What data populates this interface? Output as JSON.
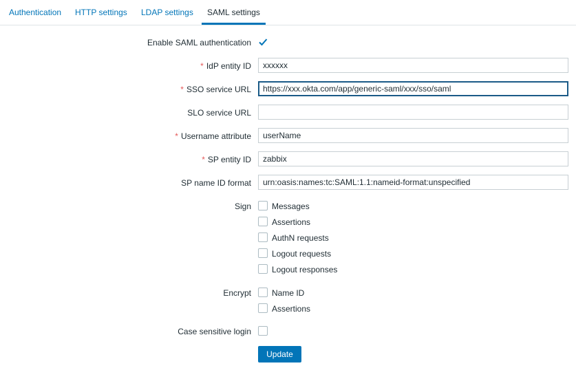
{
  "tabs": [
    {
      "label": "Authentication",
      "active": false
    },
    {
      "label": "HTTP settings",
      "active": false
    },
    {
      "label": "LDAP settings",
      "active": false
    },
    {
      "label": "SAML settings",
      "active": true
    }
  ],
  "form": {
    "enable_saml_label": "Enable SAML authentication",
    "enable_saml_checked": true,
    "idp_entity_id_label": "IdP entity ID",
    "idp_entity_id_value": "xxxxxx",
    "sso_url_label": "SSO service URL",
    "sso_url_value": "https://xxx.okta.com/app/generic-saml/xxx/sso/saml",
    "slo_url_label": "SLO service URL",
    "slo_url_value": "",
    "username_attr_label": "Username attribute",
    "username_attr_value": "userName",
    "sp_entity_id_label": "SP entity ID",
    "sp_entity_id_value": "zabbix",
    "sp_name_id_label": "SP name ID format",
    "sp_name_id_value": "urn:oasis:names:tc:SAML:1.1:nameid-format:unspecified",
    "sign_label": "Sign",
    "sign_options": [
      "Messages",
      "Assertions",
      "AuthN requests",
      "Logout requests",
      "Logout responses"
    ],
    "encrypt_label": "Encrypt",
    "encrypt_options": [
      "Name ID",
      "Assertions"
    ],
    "case_sensitive_label": "Case sensitive login",
    "required_marker": "*",
    "update_button": "Update"
  },
  "colors": {
    "accent": "#0275b8",
    "required": "#e45959",
    "text": "#1f2c33"
  }
}
